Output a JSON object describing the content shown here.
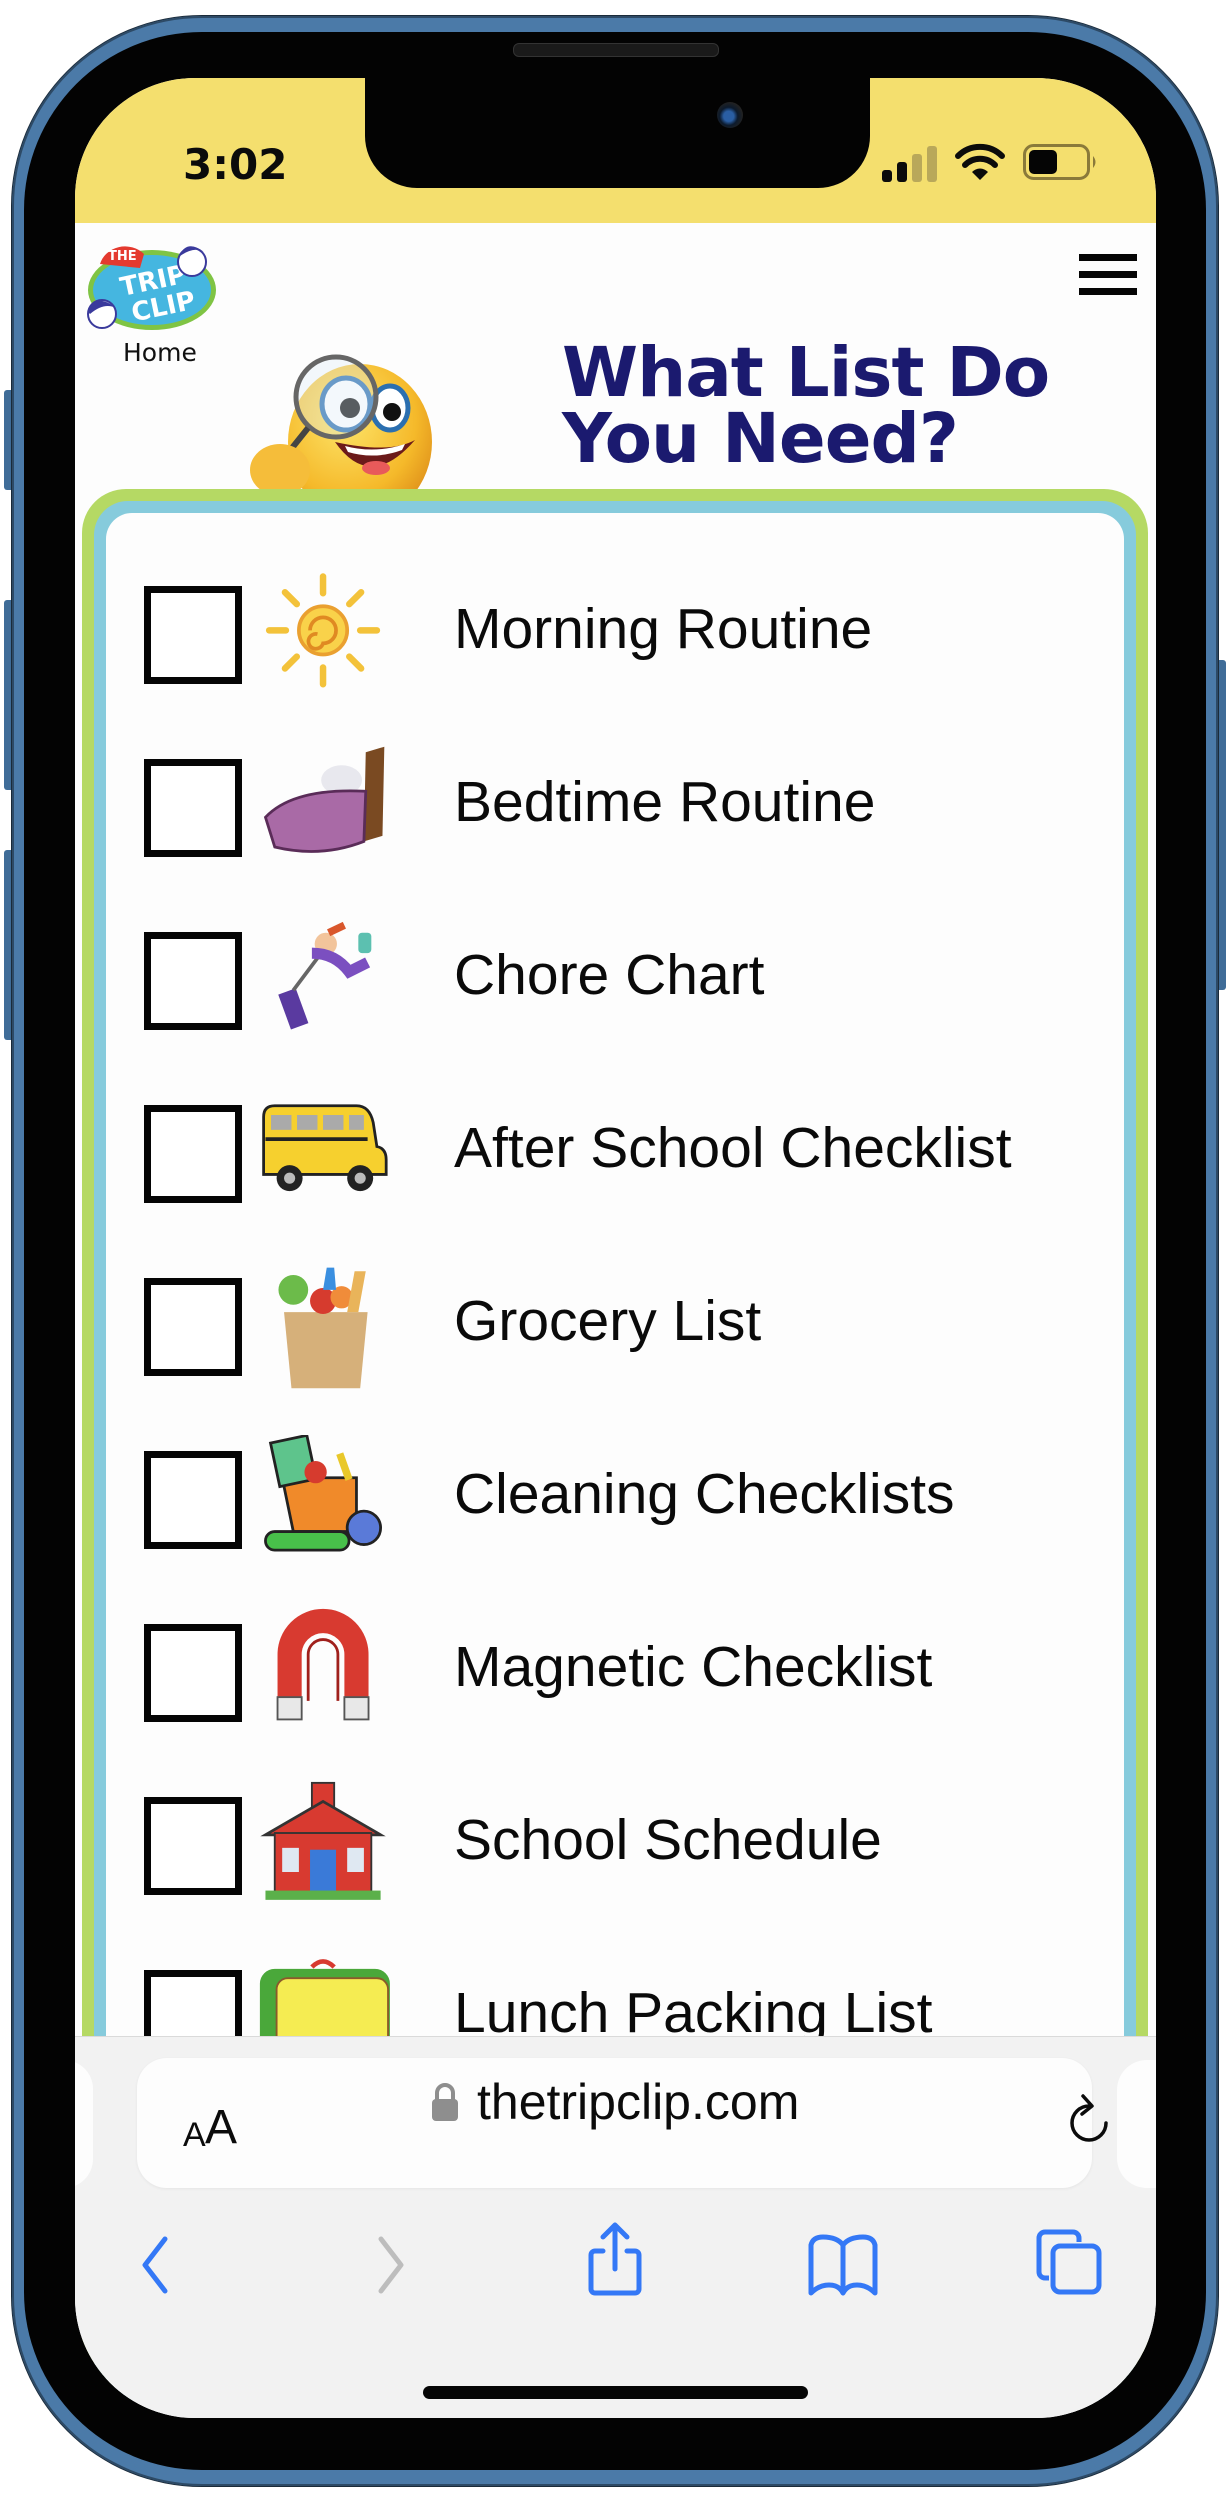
{
  "status_bar": {
    "time": "3:02",
    "signal_bars_filled": 2,
    "signal_bars_total": 4,
    "battery_level": 0.5,
    "wifi_icon": "wifi-icon",
    "battery_icon": "battery-icon"
  },
  "header": {
    "logo_alt": "The Trip Clip",
    "home_link": "Home",
    "menu_icon": "hamburger-menu-icon",
    "mascot_icon": "magnifying-glass-emoji-icon",
    "title_line1": "What List Do",
    "title_line2": "You Need?"
  },
  "colors": {
    "status_bar_bg": "#f4df6e",
    "title": "#1b1a6f",
    "card_outer_border": "#b5d964",
    "card_inner_border": "#86cbdc",
    "safari_accent": "#3478f6",
    "disabled": "#bdbdbd"
  },
  "list": {
    "items": [
      {
        "label": "Morning Routine",
        "icon": "sun-icon",
        "checked": false
      },
      {
        "label": "Bedtime Routine",
        "icon": "bed-icon",
        "checked": false
      },
      {
        "label": "Chore Chart",
        "icon": "vacuum-cleaning-person-icon",
        "checked": false
      },
      {
        "label": "After School Checklist",
        "icon": "school-bus-icon",
        "checked": false
      },
      {
        "label": "Grocery List",
        "icon": "grocery-bag-icon",
        "checked": false
      },
      {
        "label": "Cleaning Checklists",
        "icon": "toy-box-icon",
        "checked": false
      },
      {
        "label": "Magnetic Checklist",
        "icon": "magnet-icon",
        "checked": false
      },
      {
        "label": "School Schedule",
        "icon": "schoolhouse-icon",
        "checked": false
      },
      {
        "label": "Lunch Packing List",
        "icon": "lunchbox-icon",
        "checked": false
      }
    ]
  },
  "browser": {
    "text_size_label_small": "A",
    "text_size_label_large": "A",
    "url": "thetripclip.com",
    "secure": true,
    "toolbar": {
      "back": "back-chevron-icon",
      "forward": "forward-chevron-icon",
      "share": "share-icon",
      "bookmarks": "bookmarks-book-icon",
      "tabs": "tabs-icon"
    }
  }
}
